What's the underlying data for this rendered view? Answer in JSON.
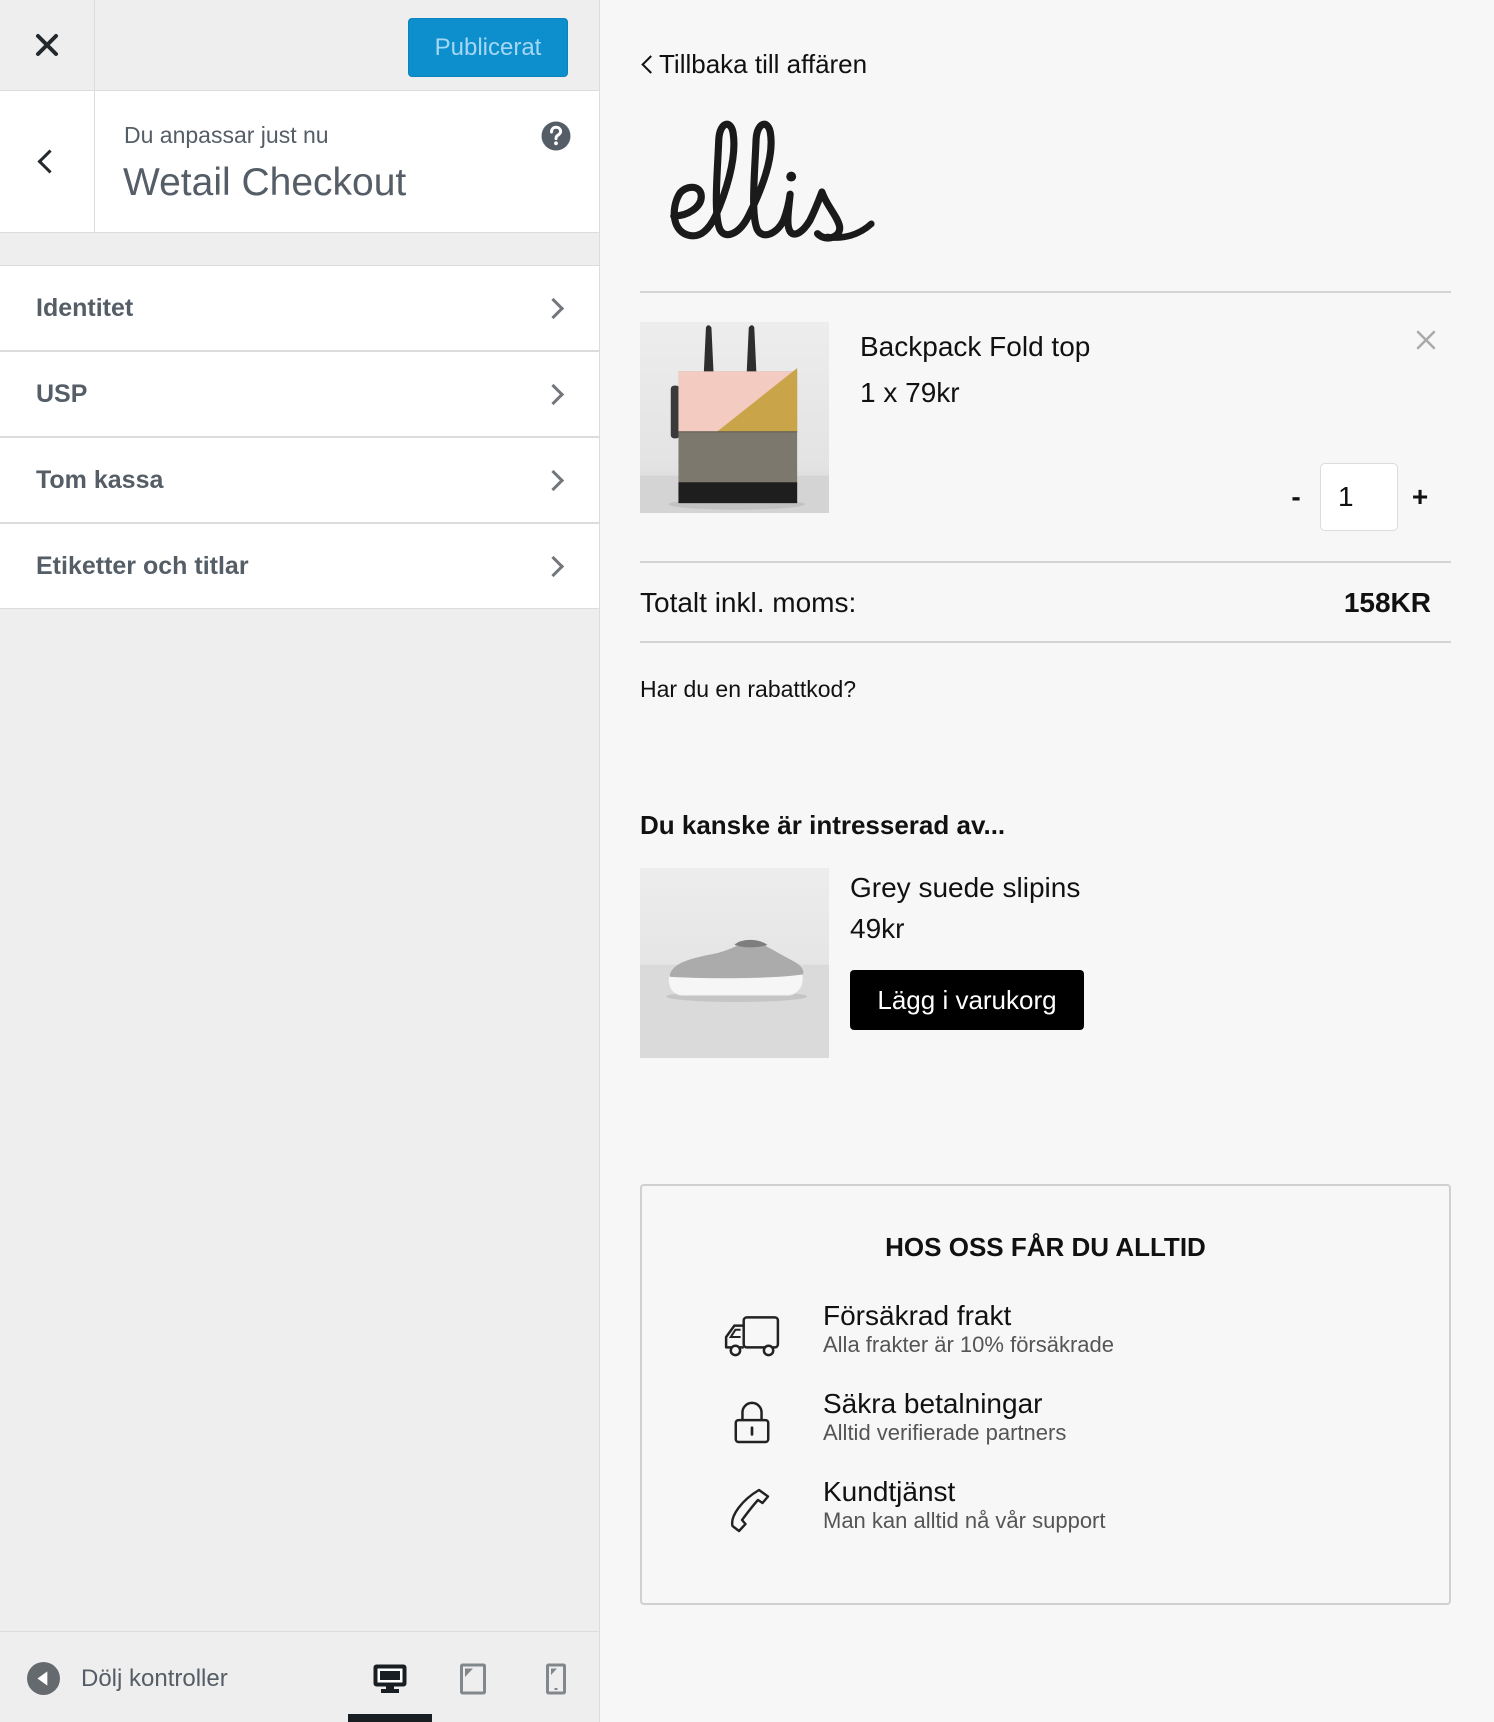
{
  "customizer": {
    "publish_label": "Publicerat",
    "info_prefix": "Du anpassar just nu",
    "info_title": "Wetail Checkout",
    "sections": [
      {
        "label": "Identitet"
      },
      {
        "label": "USP"
      },
      {
        "label": "Tom kassa"
      },
      {
        "label": "Etiketter och titlar"
      }
    ],
    "footer": {
      "collapse_label": "Dölj kontroller",
      "devices": [
        {
          "icon": "desktop-icon",
          "active": true
        },
        {
          "icon": "tablet-icon",
          "active": false
        },
        {
          "icon": "mobile-icon",
          "active": false
        }
      ]
    },
    "icons": {
      "close": "close-icon",
      "back": "chevron-left-icon",
      "help": "help-icon",
      "section_arrow": "chevron-right-icon",
      "collapse": "collapse-arrow-icon"
    }
  },
  "preview": {
    "back_link": "Tillbaka till affären",
    "logo_text": "ellis",
    "cart": {
      "items": [
        {
          "name": "Backpack Fold top",
          "price_line": "1 x 79kr",
          "quantity": "1"
        }
      ],
      "qty_decrease": "-",
      "qty_increase": "+",
      "remove_icon": "close-icon"
    },
    "total": {
      "label": "Totalt inkl. moms:",
      "value": "158KR"
    },
    "coupon_prompt": "Har du en rabattkod?",
    "upsell": {
      "heading": "Du kanske är intresserad av...",
      "products": [
        {
          "name": "Grey suede slipins",
          "price": "49kr",
          "button_label": "Lägg i varukorg"
        }
      ]
    },
    "usp": {
      "heading": "HOS OSS FÅR DU ALLTID",
      "items": [
        {
          "icon": "truck-icon",
          "title": "Försäkrad frakt",
          "subtitle": "Alla frakter är 10% försäkrade"
        },
        {
          "icon": "lock-icon",
          "title": "Säkra betalningar",
          "subtitle": "Alltid verifierade partners"
        },
        {
          "icon": "phone-icon",
          "title": "Kundtjänst",
          "subtitle": "Man kan alltid nå vår support"
        }
      ]
    }
  },
  "colors": {
    "publish_button_bg": "#0d8fcd",
    "publish_button_text": "#a5d7f3",
    "sidebar_bg": "#eeeeee",
    "sidebar_text": "#555d66",
    "preview_bg": "#f7f7f7",
    "cta_bg": "#000000",
    "cta_text": "#ffffff"
  }
}
